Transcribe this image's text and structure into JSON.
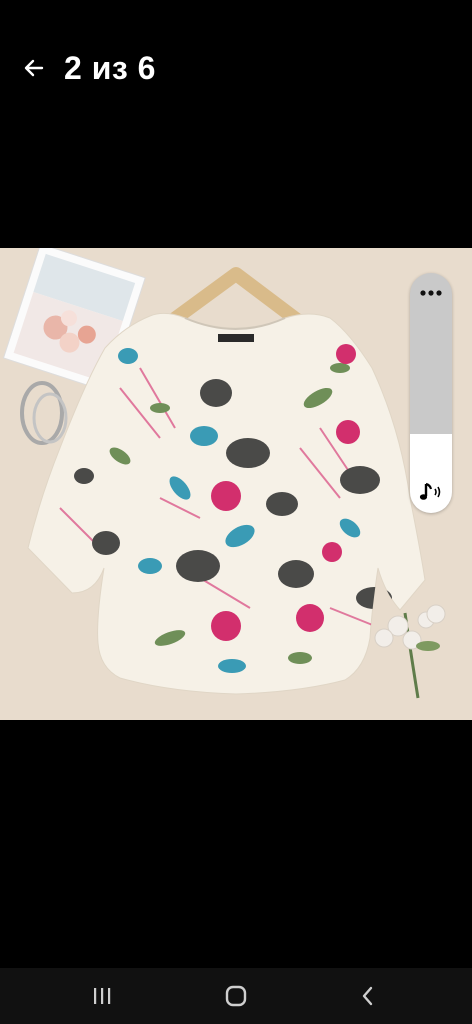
{
  "header": {
    "counter": "2 из 6"
  },
  "icons": {
    "back": "arrow-left-icon",
    "more": "more-horizontal-icon",
    "sound": "music-note-sound-icon",
    "recents": "recent-apps-icon",
    "home": "home-icon",
    "nav_back": "chevron-left-icon"
  },
  "volume": {
    "level": 0.33
  },
  "colors": {
    "background": "#000000",
    "photo_background": "#e8dccd",
    "volume_track": "#c9c9c9",
    "volume_fill": "#ffffff",
    "navbar": "#111111"
  }
}
